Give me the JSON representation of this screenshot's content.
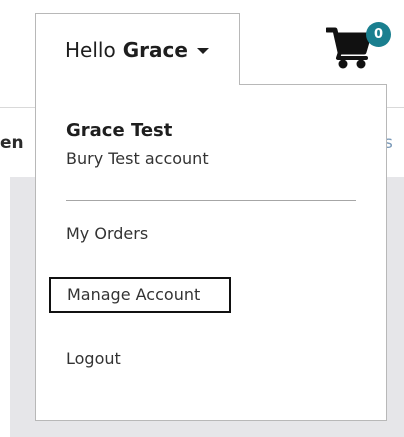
{
  "header": {
    "account_toggle": {
      "greeting": "Hello",
      "name": "Grace"
    },
    "cart": {
      "icon": "shopping-cart-icon",
      "count": "0",
      "badge_color": "#1a7f8f"
    },
    "nav_fragments": {
      "left": "en",
      "right": "s"
    }
  },
  "dropdown": {
    "user": {
      "name": "Grace Test",
      "account": "Bury Test account"
    },
    "items": [
      {
        "label": "My Orders"
      },
      {
        "label": "Manage Account",
        "focused": true
      },
      {
        "label": "Logout"
      }
    ]
  }
}
